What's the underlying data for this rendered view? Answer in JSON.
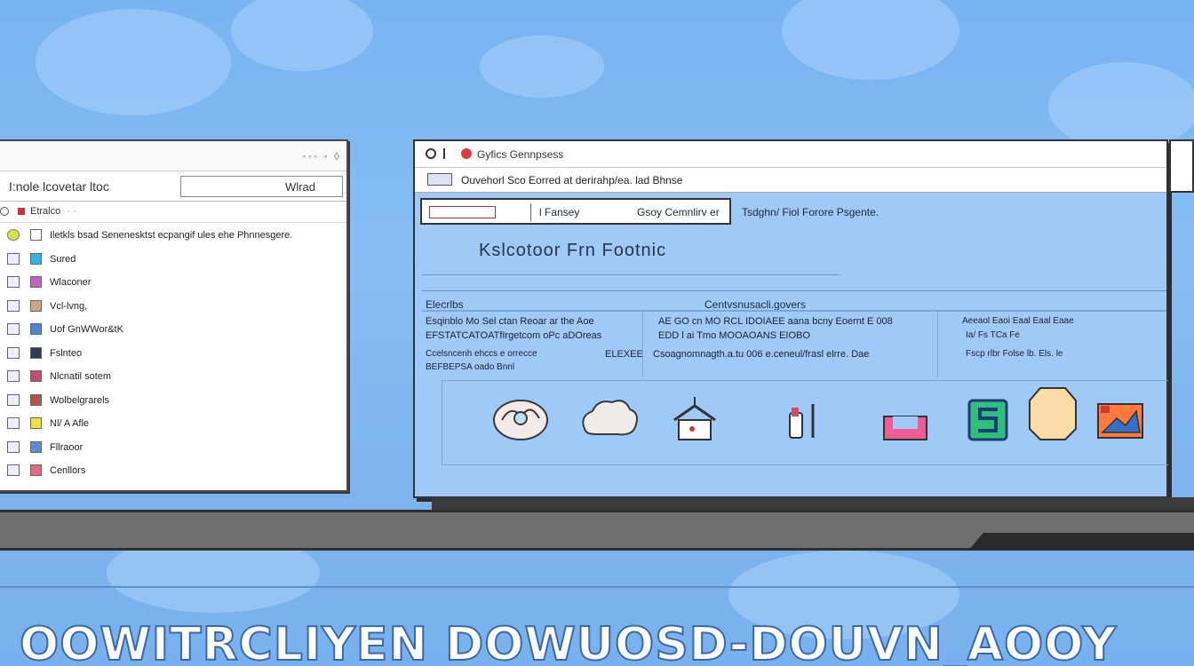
{
  "left_window": {
    "window_controls": "◦◦◦ ◦ ◊",
    "toolbar_label": "I:nole lcovetar ltoc",
    "search_value": "Wlrad",
    "path_label": "Etralco",
    "path_suffix": "· ·",
    "items": [
      {
        "label": "Iletkls bsad Senenesktst ecpangif ules ehe Phnnesgere.",
        "color": "#d7e24a"
      },
      {
        "label": "Sured",
        "color": "#2db4e8"
      },
      {
        "label": "Wlaconer",
        "color": "#c25fc8"
      },
      {
        "label": "Vcl-lvng,",
        "color": "#c7aa84"
      },
      {
        "label": "Uof GnWWor&tK",
        "color": "#4b86d8"
      },
      {
        "label": "Fslnteo",
        "color": "#303a55"
      },
      {
        "label": "Nlcnatil sotem",
        "color": "#c54a6e"
      },
      {
        "label": "Wolbelgrarels",
        "color": "#b8504a"
      },
      {
        "label": "Nl/ A Afle",
        "color": "#efe03c"
      },
      {
        "label": "Fllraoor",
        "color": "#5b8ed6"
      },
      {
        "label": "Cenllors",
        "color": "#e46a80"
      }
    ]
  },
  "right_window": {
    "title": "Gyfics Gennpsess",
    "address": "Ouvehorl Sco Eorred   at derirahp/ea. lad Bhnse",
    "tabs": {
      "tab1": "l Fansey",
      "tab2": "Gsoy Cemnlirv er"
    },
    "note": "Tsdghn/ Fiol Forore Psgente.",
    "heading": "Kslcotoor  Frn  Footnic",
    "section_left": "Elecrlbs",
    "section_mid": "Centvsnusacli.govers",
    "col1": {
      "r1": "Esqinblo  Mo Sel ctan Reoar ar the Aoe",
      "r2": "EFSTATCATOATfIrgetcom oPc aDOreas",
      "r3": "Ccelsncenh ehccs  e orrecce",
      "r4": "BEFBEPSA oado Bnnl",
      "r3b": "ELEXEE"
    },
    "col2": {
      "r1": "AE  GO cn MO RCL     IDOIAEE aana bcny  Eoernt E 008",
      "r2": "EDD  l ai  Tmo           MOOAOANS EIOBO",
      "r3": "Csoagnomnagth.a.tu  006 e.ceneul/frasl elrre.  Dae"
    },
    "col3": {
      "r1": "Aeeaol Eaoi Eaal Eaal Eaae",
      "r2": "Ia/  Fs  TCa  Fe",
      "r3": "Fscp  rlbr  Folse  lb.  Els.  le"
    },
    "icons": [
      "brain-icon",
      "cloud-icon",
      "house-icon",
      "tool-icon",
      "tray-icon",
      "app-s-icon",
      "note-icon",
      "image-icon"
    ]
  },
  "banner": "OOWITRCLIYEN DOWUOSD-DOUVN_AOOY",
  "colors": {
    "sky": "#7fb6ef",
    "window_body": "#9fc9f6",
    "stand": "#6f6f6f"
  }
}
